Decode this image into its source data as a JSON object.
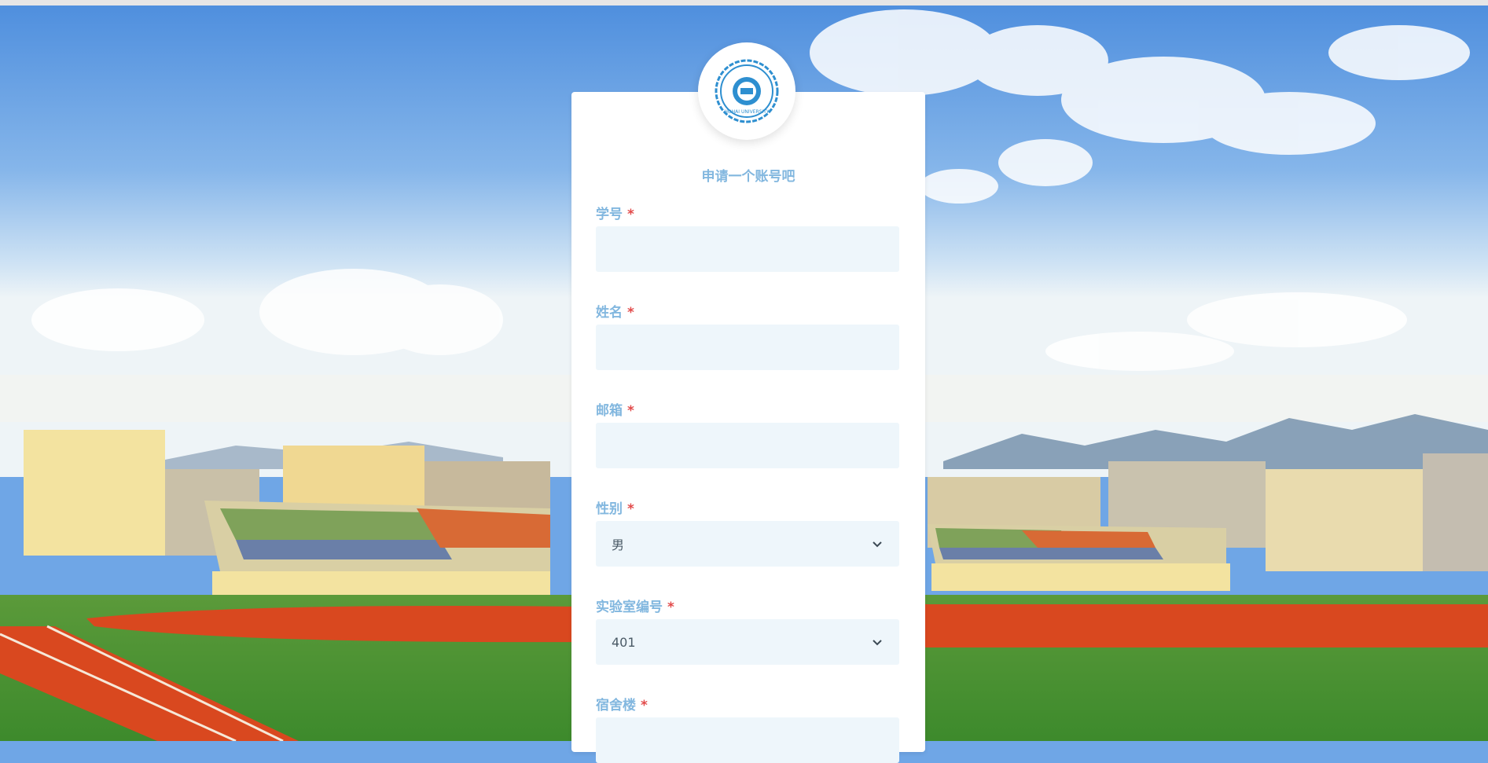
{
  "card": {
    "heading": "申请一个账号吧"
  },
  "logo": {
    "icon": "university-seal-icon",
    "seal_text": "HOHAI UNIVERSITY"
  },
  "form": {
    "required_marker": "*",
    "student_id": {
      "label": "学号",
      "value": ""
    },
    "name": {
      "label": "姓名",
      "value": ""
    },
    "email": {
      "label": "邮箱",
      "value": ""
    },
    "gender": {
      "label": "性别",
      "value": "男"
    },
    "lab_number": {
      "label": "实验室编号",
      "value": "401"
    },
    "dorm": {
      "label": "宿舍楼",
      "value": ""
    }
  },
  "colors": {
    "label": "#82b7df",
    "required": "#e24a4a",
    "input_bg": "#eef6fb",
    "card_bg": "#ffffff"
  }
}
